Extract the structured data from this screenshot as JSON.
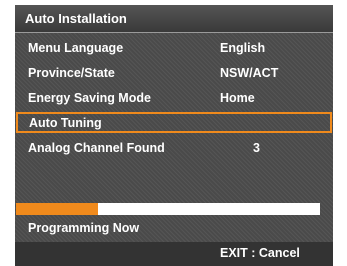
{
  "window": {
    "title": "Auto Installation"
  },
  "settings": [
    {
      "label": "Menu Language",
      "value": "English"
    },
    {
      "label": "Province/State",
      "value": "NSW/ACT"
    },
    {
      "label": "Energy Saving Mode",
      "value": "Home"
    },
    {
      "label": "Auto Tuning",
      "value": ""
    },
    {
      "label": "Analog Channel Found",
      "value": "3"
    }
  ],
  "progress": {
    "fraction": 0.27
  },
  "status": {
    "text": "Programming Now"
  },
  "footer": {
    "exit_label": "EXIT : Cancel"
  },
  "colors": {
    "accent": "#f08a1c",
    "panel": "#4a4a4a",
    "header": "#444444",
    "footer": "#333333"
  }
}
